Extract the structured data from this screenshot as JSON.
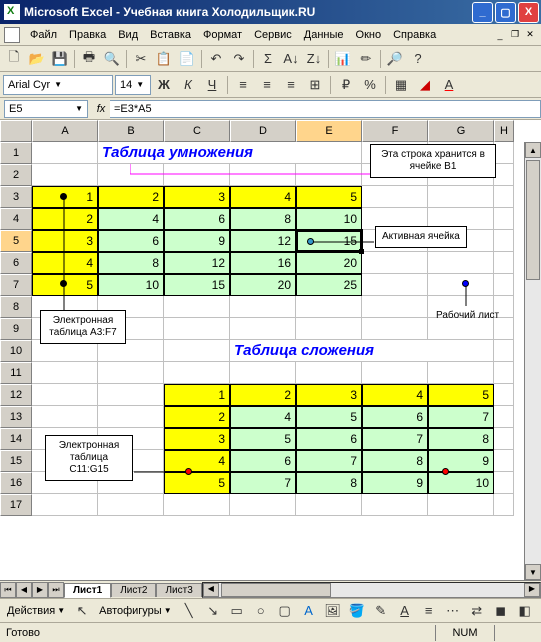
{
  "window": {
    "title": "Microsoft Excel - Учебная книга Холодильщик.RU"
  },
  "menu": {
    "file": "Файл",
    "edit": "Правка",
    "view": "Вид",
    "insert": "Вставка",
    "format": "Формат",
    "tools": "Сервис",
    "data": "Данные",
    "window": "Окно",
    "help": "Справка"
  },
  "format_bar": {
    "font": "Arial Cyr",
    "size": "14"
  },
  "formula_bar": {
    "name_box": "E5",
    "fx": "fx",
    "formula": "=E3*A5"
  },
  "columns": [
    "A",
    "B",
    "C",
    "D",
    "E",
    "F",
    "G",
    "H"
  ],
  "rows_visible": 17,
  "titles": {
    "mul": "Таблица умножения",
    "add": "Таблица сложения"
  },
  "mul_table": {
    "r3": [
      1,
      2,
      3,
      4,
      5
    ],
    "r4": [
      2,
      4,
      6,
      8,
      10
    ],
    "r5": [
      3,
      6,
      9,
      12,
      15
    ],
    "r6": [
      4,
      8,
      12,
      16,
      20
    ],
    "r7": [
      5,
      10,
      15,
      20,
      25
    ]
  },
  "add_table": {
    "r12": [
      1,
      2,
      3,
      4,
      5
    ],
    "r13": [
      2,
      4,
      5,
      6,
      7
    ],
    "r14": [
      3,
      5,
      6,
      7,
      8
    ],
    "r15": [
      4,
      6,
      7,
      8,
      9
    ],
    "r16": [
      5,
      7,
      8,
      9,
      10
    ]
  },
  "callouts": {
    "b1": "Эта строка хранится в ячейке B1",
    "active": "Активная ячейка",
    "worksheet": "Рабочий лист",
    "table1": "Электронная таблица A3:F7",
    "table2": "Электронная таблица C11:G15"
  },
  "sheets": {
    "s1": "Лист1",
    "s2": "Лист2",
    "s3": "Лист3"
  },
  "draw_bar": {
    "actions": "Действия",
    "autoshapes": "Автофигуры"
  },
  "status": {
    "ready": "Готово",
    "num": "NUM"
  }
}
